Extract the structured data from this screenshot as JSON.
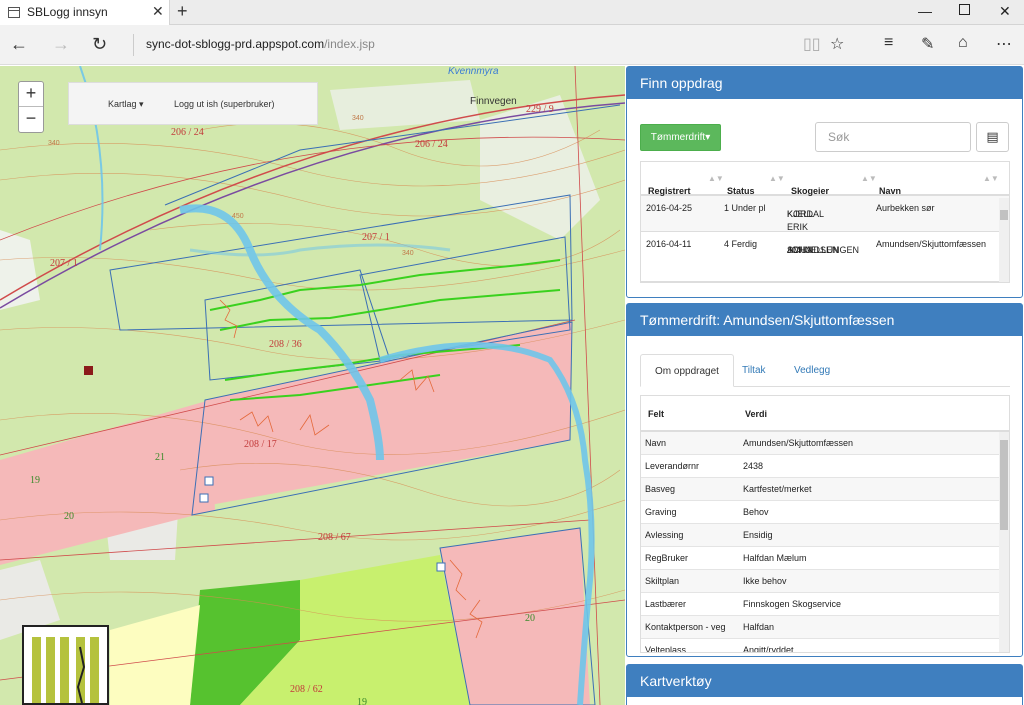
{
  "browser": {
    "tab_title": "SBLogg innsyn",
    "url_host": "sync-dot-sblogg-prd.appspot.com",
    "url_path": "/index.jsp"
  },
  "map": {
    "kartlag_label": "Kartlag",
    "logout_label": "Logg ut ish (superbruker)",
    "zoom_in": "+",
    "zoom_out": "−",
    "labels": {
      "kvennmyra": "Kvennmyra",
      "finnvegen": "Finnvegen",
      "p229_9": "229 / 9",
      "p206_24a": "206 / 24",
      "p206_24b": "206 / 24",
      "p207_1a": "207 / 1",
      "p207_1b": "207 / 1",
      "p208_36": "208 / 36",
      "p208_17": "208 / 17",
      "p208_67": "208 / 67",
      "p208_62": "208 / 62",
      "n21": "21",
      "n19a": "19",
      "n20a": "20",
      "n20b": "20",
      "n19b": "19",
      "n340a": "340",
      "n340b": "340",
      "n340c": "340",
      "n450": "450"
    }
  },
  "finn_oppdrag": {
    "title": "Finn oppdrag",
    "filter_button": "Tømmerdrift▾",
    "search_placeholder": "Søk",
    "columns": [
      "Registrert",
      "Status",
      "Skogeier",
      "Navn"
    ],
    "rows": [
      {
        "registrert": "2016-04-25",
        "status": "1 Under pl",
        "skogeier_1": "KJELL ERIK",
        "skogeier_2": "KORDAL",
        "skogeier_3": "",
        "navn": "Aurbekken sør"
      },
      {
        "registrert": "2016-04-11",
        "status": "4 Ferdig",
        "skogeier_1": "JOHN",
        "skogeier_2": "SCHJELLUNGEN",
        "skogeier_3": "AMUNDSEN",
        "navn": "Amundsen/Skjuttomfæssen"
      }
    ]
  },
  "detail": {
    "title": "Tømmerdrift: Amundsen/Skjuttomfæssen",
    "tabs": [
      "Om oppdraget",
      "Tiltak",
      "Vedlegg"
    ],
    "col_felt": "Felt",
    "col_verdi": "Verdi",
    "rows": [
      {
        "felt": "Navn",
        "verdi": "Amundsen/Skjuttomfæssen"
      },
      {
        "felt": "Leverandørnr",
        "verdi": "2438"
      },
      {
        "felt": "Basveg",
        "verdi": "Kartfestet/merket"
      },
      {
        "felt": "Graving",
        "verdi": "Behov"
      },
      {
        "felt": "Avlessing",
        "verdi": "Ensidig"
      },
      {
        "felt": "RegBruker",
        "verdi": "Halfdan Mælum"
      },
      {
        "felt": "Skiltplan",
        "verdi": "Ikke behov"
      },
      {
        "felt": "Lastbærer",
        "verdi": "Finnskogen Skogservice"
      },
      {
        "felt": "Kontaktperson - veg",
        "verdi": "Halfdan"
      },
      {
        "felt": "Velteplass",
        "verdi": "Angitt/ryddet"
      }
    ]
  },
  "kartverktoy": {
    "title": "Kartverktøy"
  }
}
